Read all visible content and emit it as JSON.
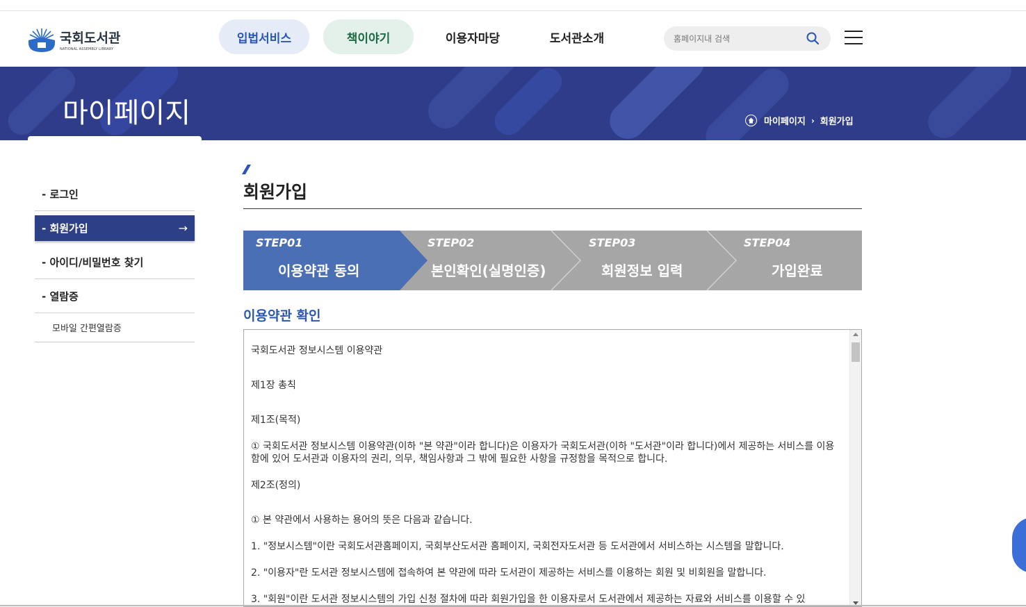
{
  "header": {
    "logo_kr": "국회도서관",
    "logo_en": "NATIONAL ASSEMBLY LIBRARY",
    "nav": [
      {
        "label": "입법서비스"
      },
      {
        "label": "책이야기"
      },
      {
        "label": "이용자마당"
      },
      {
        "label": "도서관소개"
      }
    ],
    "search_placeholder": "홈페이지내 검색"
  },
  "banner": {
    "title": "마이페이지",
    "breadcrumb": [
      "마이페이지",
      "회원가입"
    ]
  },
  "lnb": {
    "items": [
      {
        "label": "- 로그인"
      },
      {
        "label": "- 회원가입"
      },
      {
        "label": "- 아이디/비밀번호 찾기"
      },
      {
        "label": "- 열람증"
      }
    ],
    "sub": "모바일 간편열람증",
    "active_arrow": "→"
  },
  "content": {
    "title": "회원가입",
    "steps": [
      {
        "step": "STEP01",
        "name": "이용약관 동의"
      },
      {
        "step": "STEP02",
        "name": "본인확인(실명인증)"
      },
      {
        "step": "STEP03",
        "name": "회원정보 입력"
      },
      {
        "step": "STEP04",
        "name": "가입완료"
      }
    ],
    "section_title": "이용약관 확인",
    "terms": [
      "국회도서관 정보시스템 이용약관",
      "제1장 총칙",
      "제1조(목적)",
      "① 국회도서관 정보시스템 이용약관(이하 \"본 약관\"이라 합니다)은 이용자가 국회도서관(이하 \"도서관\"이라 합니다)에서 제공하는 서비스를 이용함에 있어 도서관과 이용자의 권리, 의무, 책임사항과 그 밖에 필요한 사항을 규정함을 목적으로 합니다.",
      "제2조(정의)",
      "① 본 약관에서 사용하는 용어의 뜻은 다음과 같습니다.",
      "1. \"정보시스템\"이란 국회도서관홈페이지, 국회부산도서관 홈페이지, 국회전자도서관 등 도서관에서 서비스하는 시스템을 말합니다.",
      "2. \"이용자\"란 도서관 정보시스템에 접속하여 본 약관에 따라 도서관이 제공하는 서비스를 이용하는 회원 및 비회원을 말합니다.",
      "3. \"회원\"이란 도서관 정보시스템의 가입 신청 절차에 따라 회원가입을 한 이용자로서 도서관에서 제공하는 자료와 서비스를 이용할 수 있"
    ]
  },
  "colors": {
    "banner": "#2e3c89",
    "active_step": "#4a6fb5",
    "inactive_step": "#a6a6a6",
    "accent": "#2a56b5"
  }
}
